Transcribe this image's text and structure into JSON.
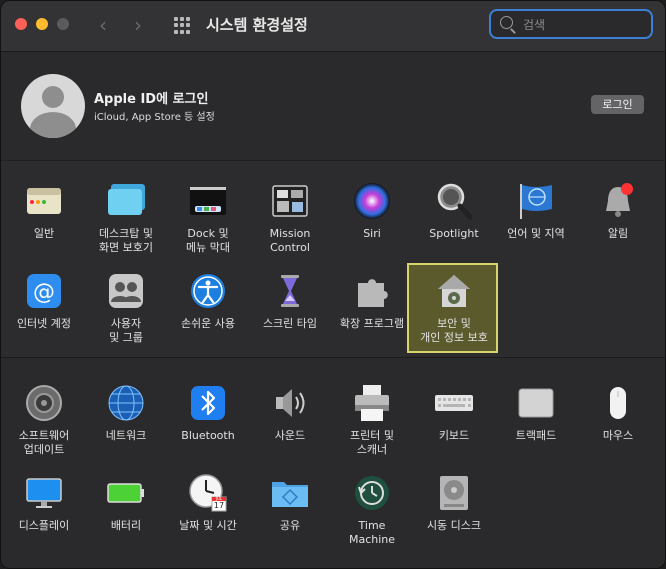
{
  "window": {
    "title": "시스템 환경설정"
  },
  "search": {
    "placeholder": "검색"
  },
  "account": {
    "title": "Apple ID에 로그인",
    "subtitle": "iCloud, App Store 등 설정",
    "login_label": "로그인"
  },
  "row1": [
    {
      "label": "일반"
    },
    {
      "label": "데스크탑 및\n화면 보호기"
    },
    {
      "label": "Dock 및\n메뉴 막대"
    },
    {
      "label": "Mission\nControl"
    },
    {
      "label": "Siri"
    },
    {
      "label": "Spotlight"
    },
    {
      "label": "언어 및 지역"
    },
    {
      "label": "알림"
    }
  ],
  "row2": [
    {
      "label": "인터넷 계정"
    },
    {
      "label": "사용자\n및 그룹"
    },
    {
      "label": "손쉬운 사용"
    },
    {
      "label": "스크린 타임"
    },
    {
      "label": "확장 프로그램"
    },
    {
      "label": "보안 및\n개인 정보 보호"
    }
  ],
  "row3": [
    {
      "label": "소프트웨어\n업데이트"
    },
    {
      "label": "네트워크"
    },
    {
      "label": "Bluetooth"
    },
    {
      "label": "사운드"
    },
    {
      "label": "프린터 및\n스캐너"
    },
    {
      "label": "키보드"
    },
    {
      "label": "트랙패드"
    },
    {
      "label": "마우스"
    }
  ],
  "row4": [
    {
      "label": "디스플레이"
    },
    {
      "label": "배터리"
    },
    {
      "label": "날짜 및 시간"
    },
    {
      "label": "공유"
    },
    {
      "label": "Time\nMachine"
    },
    {
      "label": "시동 디스크"
    }
  ],
  "calendar": {
    "month": "JUL",
    "day": "17"
  },
  "colors": {
    "accent": "#3d7fd6",
    "highlight_border": "#d6d46a",
    "highlight_fill": "#5b5a2d"
  }
}
